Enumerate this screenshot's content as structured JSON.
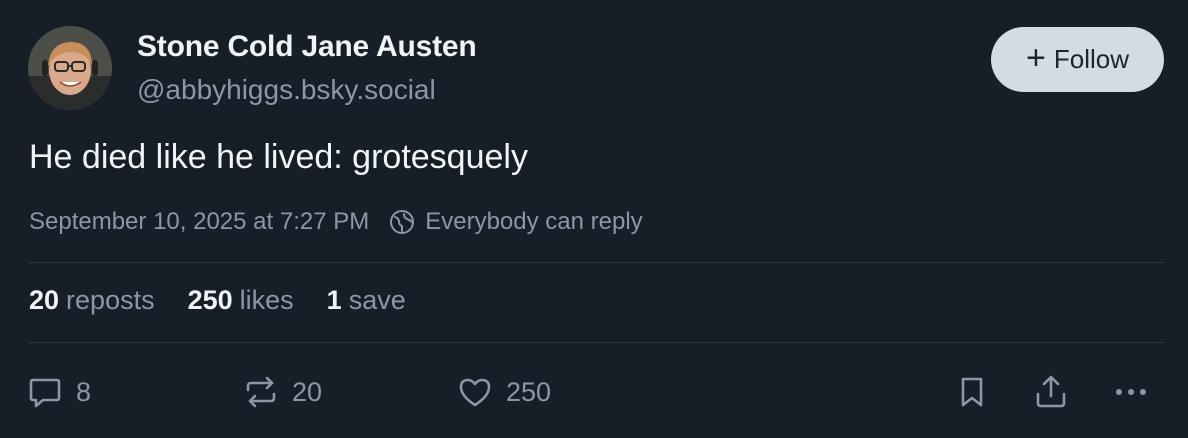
{
  "author": {
    "name": "Stone Cold Jane Austen",
    "handle": "@abbyhiggs.bsky.social"
  },
  "follow_button": {
    "label": "Follow",
    "icon": "plus-icon"
  },
  "post": {
    "text": "He died like he lived: grotesquely",
    "timestamp": "September 10, 2025 at 7:27 PM",
    "reply_setting": "Everybody can reply"
  },
  "stats": {
    "reposts": {
      "count": "20",
      "label": "reposts"
    },
    "likes": {
      "count": "250",
      "label": "likes"
    },
    "saves": {
      "count": "1",
      "label": "save"
    }
  },
  "actions": {
    "reply_count": "8",
    "repost_count": "20",
    "like_count": "250"
  },
  "colors": {
    "background": "#161e27",
    "text_primary": "#f1f3f5",
    "text_secondary": "#8a97a6",
    "follow_button_bg": "#d5dbe2",
    "divider": "#2e3946"
  }
}
